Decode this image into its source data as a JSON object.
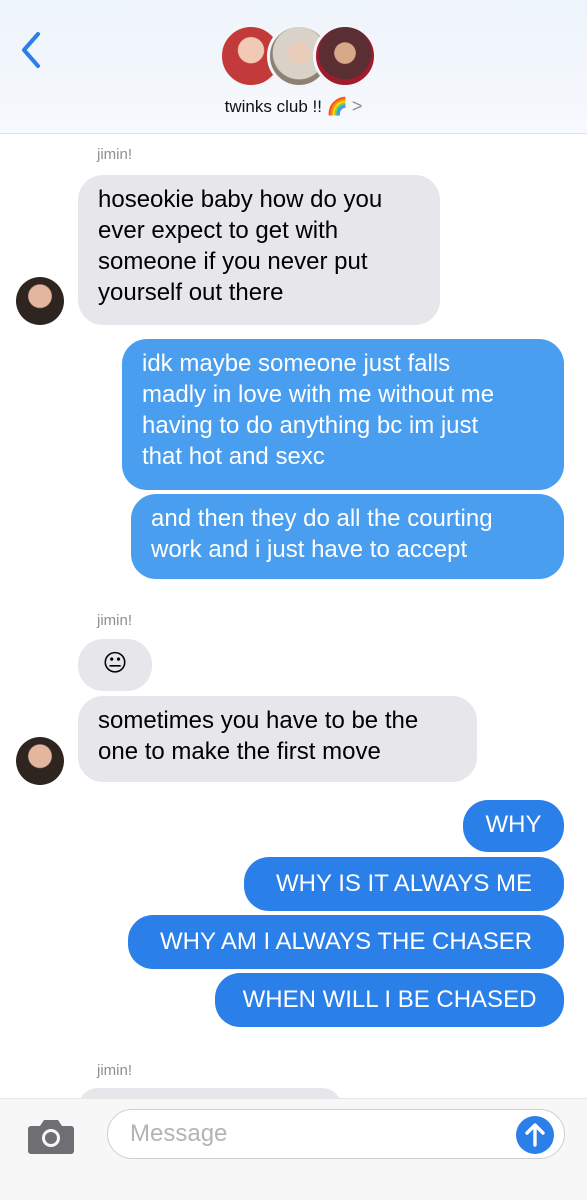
{
  "header": {
    "group_name": "twinks club !! 🌈",
    "chevron": ">"
  },
  "messages": [
    {
      "sender": "jimin!",
      "text_lines": [
        "hoseokie baby how do you",
        "ever expect to get with",
        "someone if you never put",
        "yourself out there"
      ]
    },
    {
      "from": "me",
      "text_lines": [
        "idk maybe someone just falls",
        "madly in love with me without me",
        "having to do anything bc im just",
        "that hot and sexc"
      ]
    },
    {
      "from": "me",
      "text_lines": [
        "and then they do all the courting",
        "work and i just have to accept"
      ]
    },
    {
      "sender": "jimin!",
      "text": "😐"
    },
    {
      "sender": "jimin!",
      "text_lines": [
        "sometimes you have to be the",
        "one to make the first move"
      ]
    },
    {
      "from": "me",
      "text": "WHY"
    },
    {
      "from": "me",
      "text": "WHY IS IT ALWAYS ME"
    },
    {
      "from": "me",
      "text": "WHY AM I ALWAYS THE CHASER"
    },
    {
      "from": "me",
      "text": "WHEN WILL I BE CHASED"
    },
    {
      "sender": "jimin!"
    }
  ],
  "composer": {
    "placeholder": "Message"
  },
  "colors": {
    "incoming_bubble": "#e6e6eb",
    "outgoing_bubble": "#4a9eef",
    "outgoing_bubble_dark": "#2b7fe8",
    "accent": "#2b7fe8"
  },
  "icons": {
    "back": "chevron-left-icon",
    "camera": "camera-icon",
    "send": "arrow-up-icon"
  }
}
